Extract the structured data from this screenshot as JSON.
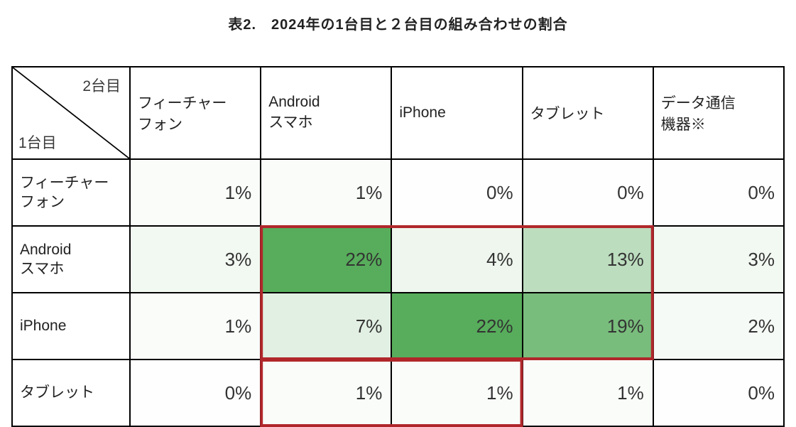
{
  "title": "表2.　2024年の1台目と２台目の組み合わせの割合",
  "axis": {
    "col_label": "2台目",
    "row_label": "1台目"
  },
  "columns": [
    "フィーチャー\nフォン",
    "Android\nスマホ",
    "iPhone",
    "タブレット",
    "データ通信\n機器※"
  ],
  "rows": [
    "フィーチャー\nフォン",
    "Android\nスマホ",
    "iPhone",
    "タブレット"
  ],
  "chart_data": {
    "type": "heatmap",
    "title": "表2.　2024年の1台目と２台目の組み合わせの割合",
    "xlabel": "2台目",
    "ylabel": "1台目",
    "x_categories": [
      "フィーチャーフォン",
      "Androidスマホ",
      "iPhone",
      "タブレット",
      "データ通信機器※"
    ],
    "y_categories": [
      "フィーチャーフォン",
      "Androidスマホ",
      "iPhone",
      "タブレット"
    ],
    "unit": "percent",
    "values": [
      [
        1,
        1,
        0,
        0,
        0
      ],
      [
        3,
        22,
        4,
        13,
        3
      ],
      [
        1,
        7,
        22,
        19,
        2
      ],
      [
        0,
        1,
        1,
        1,
        0
      ]
    ],
    "value_labels": [
      [
        "1%",
        "1%",
        "0%",
        "0%",
        "0%"
      ],
      [
        "3%",
        "22%",
        "4%",
        "13%",
        "3%"
      ],
      [
        "1%",
        "7%",
        "22%",
        "19%",
        "2%"
      ],
      [
        "0%",
        "1%",
        "1%",
        "1%",
        "0%"
      ]
    ],
    "color_scale": {
      "low": "#fdfefd",
      "mid": "#d3e8d4",
      "high": "#57ad5b"
    },
    "highlight_boxes": [
      {
        "note": "2×3 block",
        "row_start": 1,
        "row_end": 2,
        "col_start": 1,
        "col_end": 3,
        "color": "#b0272b"
      },
      {
        "note": "tablet row AS+iPhone",
        "row_start": 3,
        "row_end": 3,
        "col_start": 1,
        "col_end": 2,
        "color": "#b0272b"
      }
    ]
  },
  "colors": {
    "border": "#000000",
    "highlight_border": "#b0272b"
  }
}
